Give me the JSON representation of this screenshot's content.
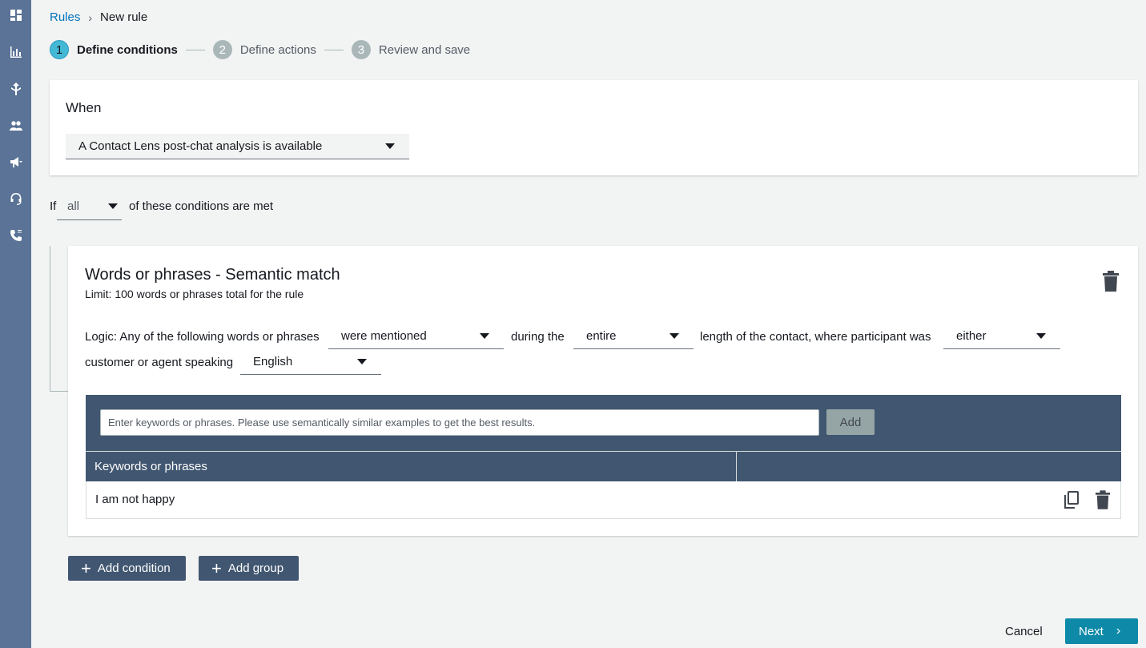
{
  "sidebar": {
    "icons": [
      "dashboard-icon",
      "analytics-icon",
      "routing-icon",
      "users-icon",
      "campaigns-icon",
      "headset-icon",
      "phone-icon"
    ]
  },
  "breadcrumb": {
    "root": "Rules",
    "separator": "›",
    "current": "New rule"
  },
  "steps": [
    {
      "num": "1",
      "label": "Define conditions",
      "active": true
    },
    {
      "num": "2",
      "label": "Define actions",
      "active": false
    },
    {
      "num": "3",
      "label": "Review and save",
      "active": false
    }
  ],
  "when": {
    "title": "When",
    "trigger": "A Contact Lens post-chat analysis is available"
  },
  "if_row": {
    "prefix": "If",
    "quantifier": "all",
    "suffix": "of these conditions are met"
  },
  "condition": {
    "title": "Words or phrases - Semantic match",
    "limit": "Limit: 100 words or phrases total for the rule",
    "logic_prefix": "Logic: Any of the following words or phrases",
    "mentioned": "were mentioned",
    "during": "during the",
    "period": "entire",
    "length": "length of the contact, where participant was",
    "participant": "either",
    "speaking": "customer or agent speaking",
    "language": "English"
  },
  "keywords": {
    "placeholder": "Enter keywords or phrases. Please use semantically similar examples to get the best results.",
    "add_label": "Add",
    "column_header": "Keywords or phrases",
    "rows": [
      "I am not happy"
    ]
  },
  "buttons": {
    "add_condition": "Add condition",
    "add_group": "Add group",
    "cancel": "Cancel",
    "next": "Next"
  },
  "colors": {
    "sidebar": "#5a7396",
    "panel": "#415670",
    "link": "#0073bb",
    "primary": "#0e8aa8",
    "active_step": "#44b9d6"
  }
}
